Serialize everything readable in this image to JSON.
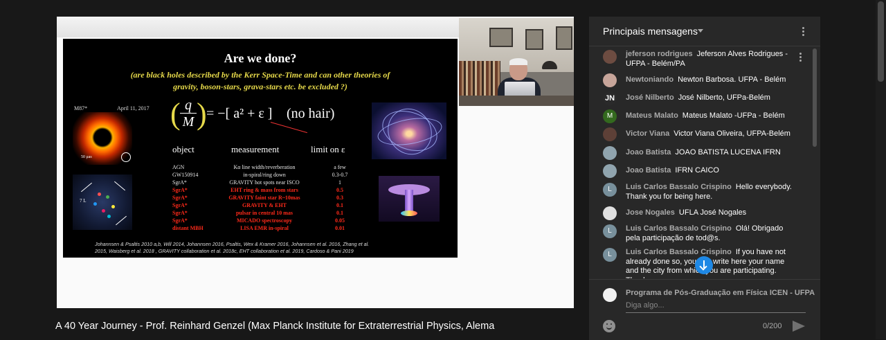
{
  "video": {
    "title": "A 40 Year Journey - Prof. Reinhard Genzel (Max Planck Institute for Extraterrestrial Physics, Alema",
    "slide": {
      "title": "Are we done?",
      "subtitle_1": "(are black holes described by the Kerr Space-Time and can other theories of",
      "subtitle_2": "gravity, boson-stars, grava-stars etc. be excluded ?)",
      "m87_label": "M87*",
      "m87_date": "April 11, 2017",
      "m87_scale": "50 μas",
      "sgr_label": "7 L",
      "equation": {
        "num": "q",
        "den": "M",
        "rest": "= −[ a² + ε ]",
        "note": "(no hair)"
      },
      "headers": {
        "object": "object",
        "measurement": "measurement",
        "limit": "limit on ε"
      },
      "rows": [
        {
          "object": "AGN",
          "measurement": "Kα  line width/reverberation",
          "limit": "a few",
          "style": "white"
        },
        {
          "object": "GW150914",
          "measurement": "in-spiral/ring down",
          "limit": "0.3-0.7",
          "style": "white"
        },
        {
          "object": "SgrA*",
          "measurement": "GRAVITY hot spots near ISCO",
          "limit": "1",
          "style": "white"
        },
        {
          "object": "SgrA*",
          "measurement": "EHT ring & mass from stars",
          "limit": "0.5",
          "style": "red"
        },
        {
          "object": "SgrA*",
          "measurement": "GRAVITY  faint star R~10mas",
          "limit": "0.3",
          "style": "red"
        },
        {
          "object": "SgrA*",
          "measurement": "GRAVITY & EHT",
          "limit": "0.1",
          "style": "red"
        },
        {
          "object": "SgrA*",
          "measurement": "pulsar in central 10 mas",
          "limit": "0.1",
          "style": "red"
        },
        {
          "object": "SgrA*",
          "measurement": "MICADO spectroscopy",
          "limit": "0.05",
          "style": "red"
        },
        {
          "object": "distant MBH",
          "measurement": "LISA EMR in-spiral",
          "limit": "0.01",
          "style": "red"
        }
      ],
      "refs_1": "Johannsen & Psaltis 2010 a,b, Will 2014, Johannsen 2016, Psaltis, Wex & Kramer 2016, Johannsen et al. 2016, Zhang et al.",
      "refs_2": "2015, Waisberg et  al. 2018 , GRAVITY collaboration et al. 2018c, EHT collaboration et al. 2019, Cardoso & Pani 2019"
    }
  },
  "chat": {
    "header_title": "Principais mensagens",
    "messages": [
      {
        "author": "jeferson rodrigues",
        "text": "Jeferson Alves Rodrigues - UFPA - Belém/PA",
        "avatar": "",
        "avatar_color": "#6d4c41"
      },
      {
        "author": "Newtoniando",
        "text": "Newton Barbosa. UFPA - Belém",
        "avatar": "",
        "avatar_color": "#c7a59a"
      },
      {
        "author": "José Nilberto",
        "text": "José Nilberto, UFPa-Belém",
        "avatar": "JN",
        "avatar_color": "#2a2a2a"
      },
      {
        "author": "Mateus Malato",
        "text": "Mateus Malato -UFPa - Belém",
        "avatar": "M",
        "avatar_color": "#33691e"
      },
      {
        "author": "Victor Viana",
        "text": "Victor Viana Oliveira, UFPA-Belém",
        "avatar": "",
        "avatar_color": "#5d4037"
      },
      {
        "author": "Joao Batista",
        "text": "JOAO BATISTA LUCENA IFRN",
        "avatar": "",
        "avatar_color": "#90a4ae"
      },
      {
        "author": "Joao Batista",
        "text": "IFRN CAICO",
        "avatar": "",
        "avatar_color": "#90a4ae"
      },
      {
        "author": "Luis Carlos Bassalo Crispino",
        "text": "Hello everybody. Thank you for being here.",
        "avatar": "L",
        "avatar_color": "#78909c"
      },
      {
        "author": "Jose Nogales",
        "text": "UFLA José Nogales",
        "avatar": "",
        "avatar_color": "#e0e0e0"
      },
      {
        "author": "Luis Carlos Bassalo Crispino",
        "text": "Olá! Obrigado pela participação de tod@s.",
        "avatar": "L",
        "avatar_color": "#78909c"
      },
      {
        "author": "Luis Carlos Bassalo Crispino",
        "text": "If you have not already done so, you can write here your name and the city from which you are participating. Thank you.",
        "avatar": "L",
        "avatar_color": "#78909c"
      }
    ],
    "composer": {
      "author": "Programa de Pós-Graduação em Física ICEN - UFPA",
      "placeholder": "Diga algo...",
      "counter": "0/200"
    }
  }
}
